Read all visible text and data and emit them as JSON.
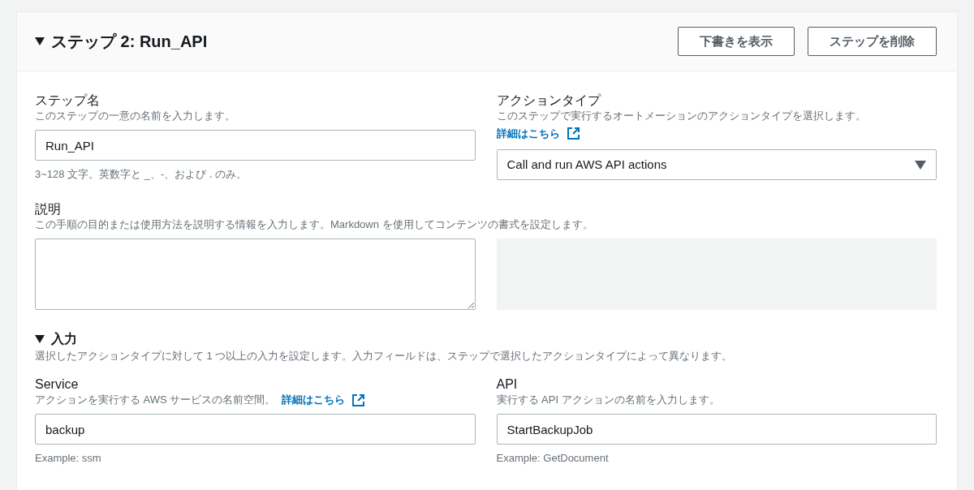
{
  "step": {
    "title": "ステップ 2: Run_API",
    "expanded": true,
    "buttons": [
      "下書きを表示",
      "ステップを削除"
    ]
  },
  "step_name": {
    "label": "ステップ名",
    "description": "このステップの一意の名前を入力します。",
    "value": "Run_API",
    "hint": "3~128 文字。英数字と _、-、および . のみ。"
  },
  "action_type": {
    "label": "アクションタイプ",
    "description": "このステップで実行するオートメーションのアクションタイプを選択します。",
    "link": "詳細はこちら",
    "value": "Call and run AWS API actions"
  },
  "description": {
    "label": "説明",
    "description": "この手順の目的または使用方法を説明する情報を入力します。Markdown を使用してコンテンツの書式を設定します。"
  },
  "inputs": {
    "title": "入力",
    "expanded": true,
    "description": "選択したアクションタイプに対して 1 つ以上の入力を設定します。入力フィールドは、ステップで選択したアクションタイプによって異なります。",
    "fields": [
      {
        "label": "Service",
        "description": "アクションを実行する AWS サービスの名前空間。",
        "link": "詳細はこちら",
        "value": "backup",
        "hint": "Example: ssm"
      },
      {
        "label": "API",
        "description": "実行する API アクションの名前を入力します。",
        "value": "StartBackupJob",
        "hint": "Example: GetDocument"
      }
    ]
  }
}
